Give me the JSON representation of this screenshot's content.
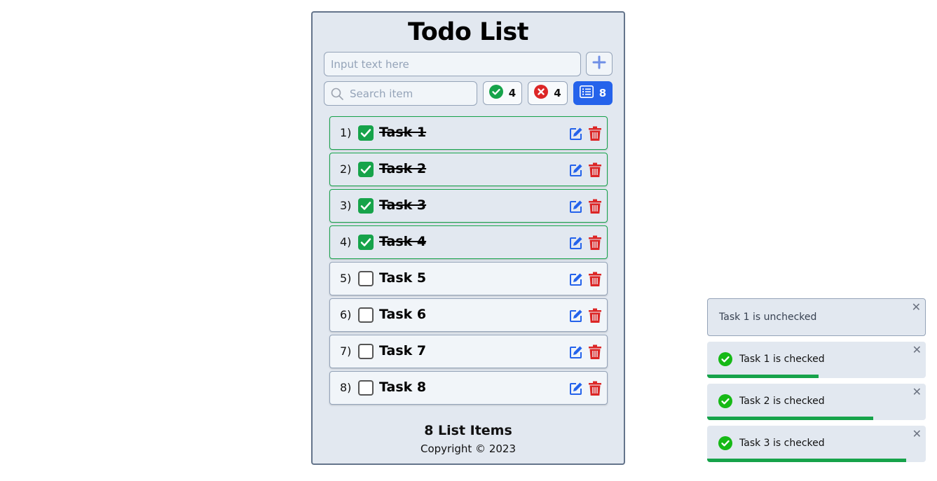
{
  "app": {
    "title": "Todo List",
    "input_placeholder": "Input text here",
    "search_placeholder": "Search item"
  },
  "filters": {
    "done_count": "4",
    "undone_count": "4",
    "all_count": "8"
  },
  "tasks": [
    {
      "num": "1)",
      "label": "Task 1",
      "checked": true
    },
    {
      "num": "2)",
      "label": "Task 2",
      "checked": true
    },
    {
      "num": "3)",
      "label": "Task 3",
      "checked": true
    },
    {
      "num": "4)",
      "label": "Task 4",
      "checked": true
    },
    {
      "num": "5)",
      "label": "Task 5",
      "checked": false
    },
    {
      "num": "6)",
      "label": "Task 6",
      "checked": false
    },
    {
      "num": "7)",
      "label": "Task 7",
      "checked": false
    },
    {
      "num": "8)",
      "label": "Task 8",
      "checked": false
    }
  ],
  "footer": {
    "count_text": "8 List Items",
    "copyright": "Copyright © 2023"
  },
  "toasts": [
    {
      "message": "Task 1 is unchecked",
      "type": "info",
      "progress": 0
    },
    {
      "message": "Task 1 is checked",
      "type": "success",
      "progress": 0.51
    },
    {
      "message": "Task 2 is checked",
      "type": "success",
      "progress": 0.76
    },
    {
      "message": "Task 3 is checked",
      "type": "success",
      "progress": 0.91
    }
  ],
  "colors": {
    "accent": "#2563eb",
    "success": "#16a34a",
    "danger": "#dc2626",
    "card_bg": "#e2e8f0"
  },
  "icons": {
    "add": "plus-icon",
    "search": "search-icon",
    "done": "check-circle-icon",
    "undone": "x-circle-icon",
    "all": "list-icon",
    "edit": "edit-icon",
    "delete": "trash-icon",
    "close": "close-icon"
  }
}
